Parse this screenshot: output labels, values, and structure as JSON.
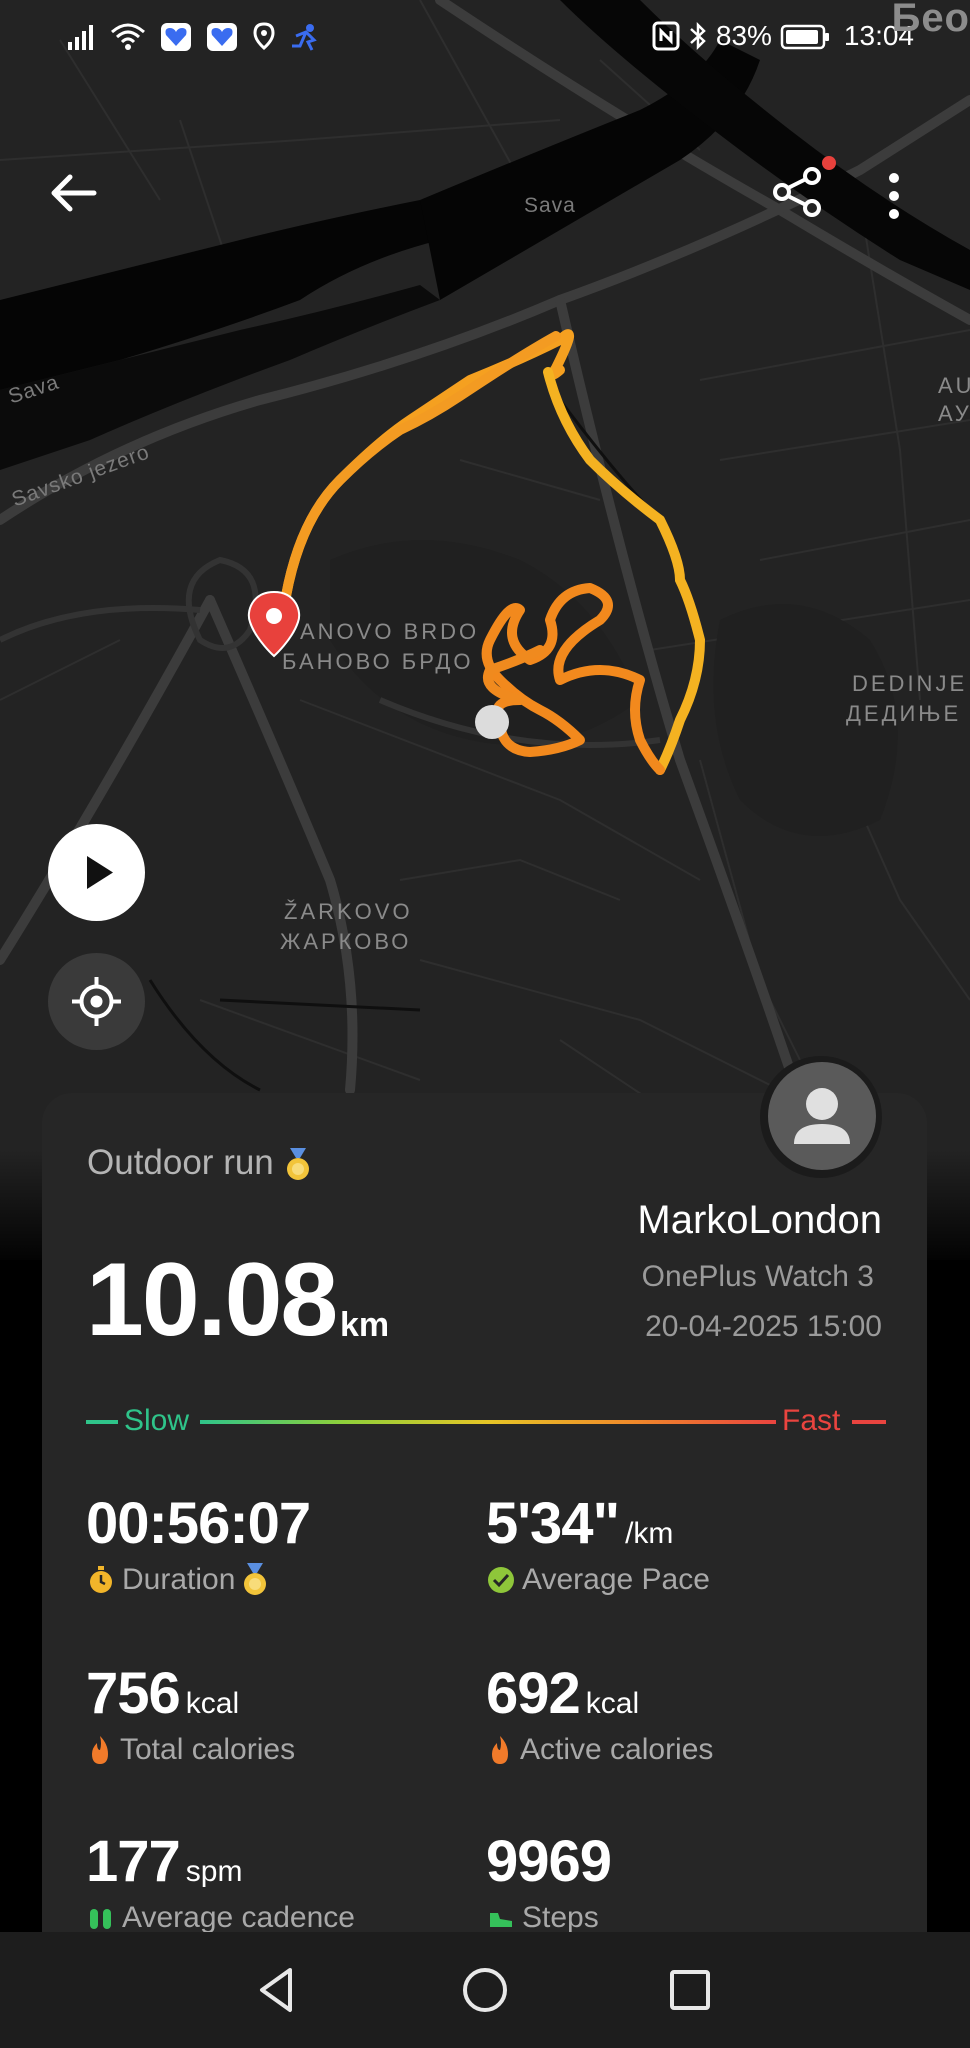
{
  "status_bar": {
    "battery": "83%",
    "time": "13:04"
  },
  "map": {
    "corner_city": "Бео",
    "labels": {
      "sava_top": "Sava",
      "sava_left": "Sava",
      "lake": "Savsko jezero",
      "banovo_latin": "ANOVO BRDO",
      "banovo_cyr": "БАНОВО БРДО",
      "dedinje_latin": "DEDINJE",
      "dedinje_cyr": "ДЕДИЊЕ",
      "zarkovo_latin": "ŽARKOVO",
      "zarkovo_cyr": "ЖАРКОВО",
      "au_latin": "AU",
      "au_cyr": "АУ"
    }
  },
  "toolbar": {
    "back_icon": "arrow-left-icon",
    "share_icon": "share-icon",
    "more_icon": "more-vertical-icon"
  },
  "activity": {
    "type": "Outdoor run",
    "user": "MarkoLondon",
    "device": "OnePlus Watch 3",
    "datetime": "20-04-2025 15:00",
    "distance_value": "10.08",
    "distance_unit": "km"
  },
  "pace_legend": {
    "slow": "Slow",
    "fast": "Fast",
    "slow_color": "#2fc48a",
    "fast_color": "#e9443f"
  },
  "stats": {
    "duration": {
      "value": "00:56:07",
      "unit": "",
      "label": "Duration"
    },
    "avg_pace": {
      "value": "5'34\"",
      "unit": "/km",
      "label": "Average Pace"
    },
    "total_cal": {
      "value": "756",
      "unit": "kcal",
      "label": "Total calories"
    },
    "active_cal": {
      "value": "692",
      "unit": "kcal",
      "label": "Active calories"
    },
    "cadence": {
      "value": "177",
      "unit": "spm",
      "label": "Average cadence"
    },
    "steps": {
      "value": "9969",
      "unit": "",
      "label": "Steps"
    }
  },
  "colors": {
    "route_start": "#f5c51f",
    "route_end": "#f07f1c",
    "start_pin": "#e8413c"
  }
}
